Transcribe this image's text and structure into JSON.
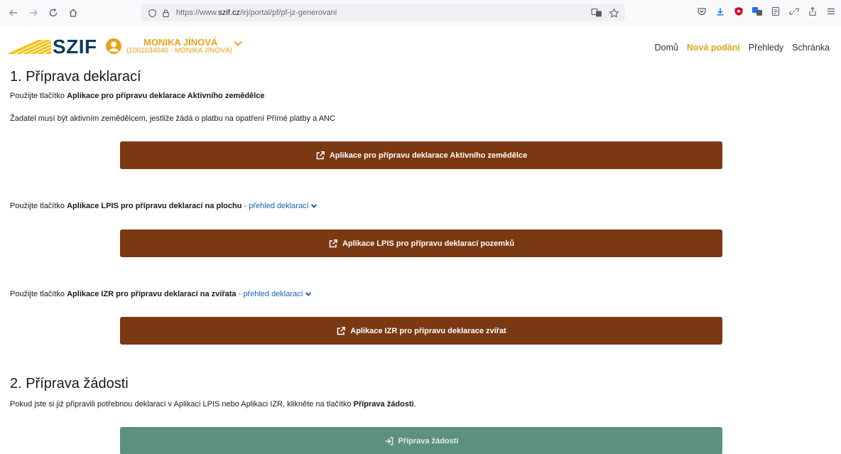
{
  "browser": {
    "url_prefix": "https://www.",
    "url_domain": "szif.cz",
    "url_path": "/irj/portal/pf/pf-jz-generovani"
  },
  "header": {
    "logo": "SZIF",
    "user_name": "MONIKA JÍNOVÁ",
    "user_sub": "(1001034040 - MONIKA JÍNOVÁ)",
    "nav": [
      {
        "label": "Domů",
        "active": false
      },
      {
        "label": "Nová podání",
        "active": true
      },
      {
        "label": "Přehledy",
        "active": false
      },
      {
        "label": "Schránka",
        "active": false
      }
    ]
  },
  "section1": {
    "title": "1. Příprava deklarací",
    "p1_pre": "Použijte tlačítko ",
    "p1_bold": "Aplikace pro přípravu deklarace Aktivního zemědělce",
    "p2": "Žadatel musí být aktivním zemědělcem, jestliže žádá o platbu na opatření Přímé platby a ANC",
    "btn1": "Aplikace pro přípravu deklarace Aktivního zemědělce",
    "p3_pre": "Použijte tlačítko ",
    "p3_bold": "Aplikace LPIS pro přípravu deklarací na plochu",
    "p3_sep": " - ",
    "p3_link": "přehled deklarací",
    "btn2": "Aplikace LPIS pro přípravu deklarací pozemků",
    "p4_pre": "Použijte tlačítko ",
    "p4_bold": "Aplikace IZR pro přípravu deklarací na zvířata",
    "p4_sep": " - ",
    "p4_link": "přehled deklarací",
    "btn3": "Aplikace IZR pro přípravu deklarace zvířat"
  },
  "section2": {
    "title": "2. Příprava žádosti",
    "p_pre": "Pokud jste si již připravili potřebnou deklaraci v Aplikaci LPIS nebo Aplikaci IZR, klikněte na tlačítko ",
    "p_bold": "Příprava žádosti",
    "p_post": ".",
    "btn": "Příprava žádosti"
  },
  "colors": {
    "brand_brown": "#7a3813",
    "disabled_green": "#5e907f",
    "accent_yellow": "#e7a21c",
    "logo_blue": "#0b3a5e",
    "link_blue": "#1a5fb4"
  }
}
